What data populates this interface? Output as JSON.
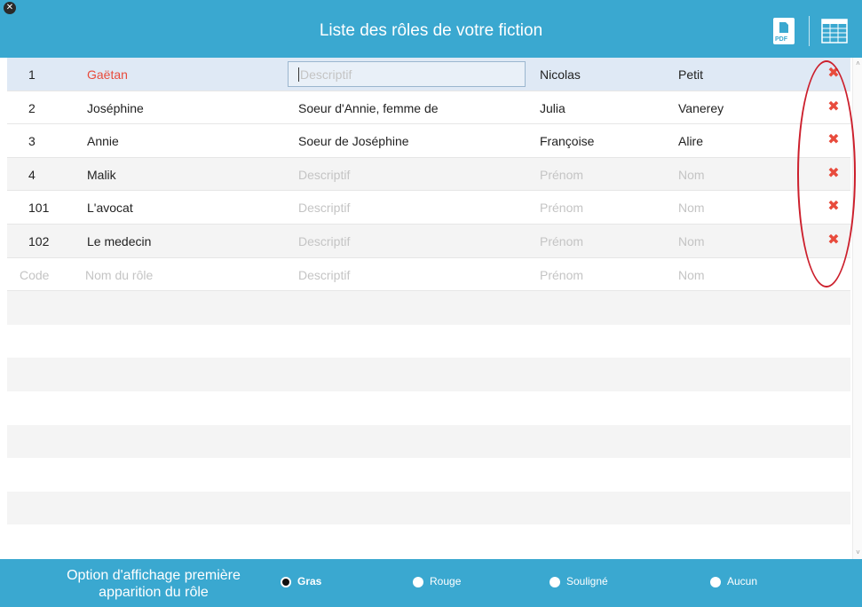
{
  "header": {
    "title": "Liste des rôles de votre fiction",
    "pdf_label": "PDF"
  },
  "placeholders": {
    "code": "Code",
    "name": "Nom du rôle",
    "description": "Descriptif",
    "first_name": "Prénom",
    "last_name": "Nom"
  },
  "roles": [
    {
      "code": "1",
      "name": "Gaëtan",
      "description": "",
      "first_name": "Nicolas",
      "last_name": "Petit"
    },
    {
      "code": "2",
      "name": "Joséphine",
      "description": "Soeur d'Annie, femme de",
      "first_name": "Julia",
      "last_name": "Vanerey"
    },
    {
      "code": "3",
      "name": "Annie",
      "description": "Soeur de Joséphine",
      "first_name": "Françoise",
      "last_name": "Alire"
    },
    {
      "code": "4",
      "name": "Malik",
      "description": "",
      "first_name": "",
      "last_name": ""
    },
    {
      "code": "101",
      "name": "L'avocat",
      "description": "",
      "first_name": "",
      "last_name": ""
    },
    {
      "code": "102",
      "name": "Le medecin",
      "description": "",
      "first_name": "",
      "last_name": ""
    }
  ],
  "delete_icon": "✖",
  "footer": {
    "label_line1": "Option d'affichage première",
    "label_line2": "apparition du rôle",
    "options": [
      {
        "label": "Gras",
        "selected": true
      },
      {
        "label": "Rouge",
        "selected": false
      },
      {
        "label": "Souligné",
        "selected": false
      },
      {
        "label": "Aucun",
        "selected": false
      }
    ]
  },
  "colors": {
    "accent": "#3aa8d0",
    "delete": "#e84b3c",
    "annotation": "#cc1f2c",
    "first_appearance": "#e84b3c"
  }
}
